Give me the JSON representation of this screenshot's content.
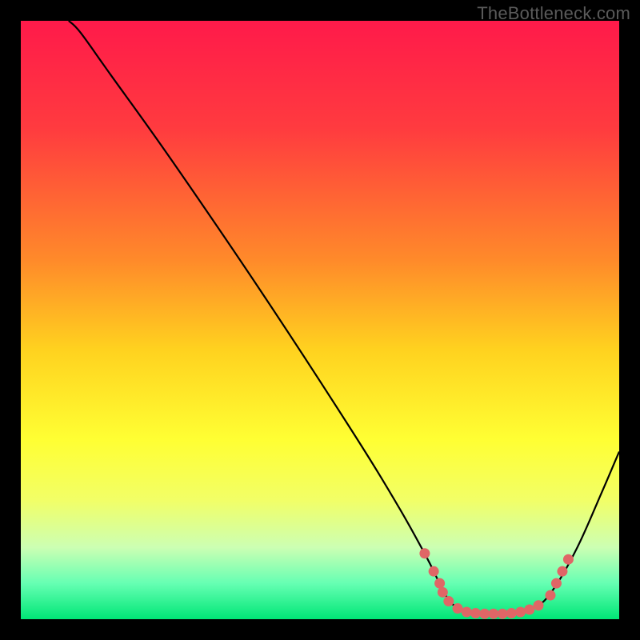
{
  "watermark": "TheBottleneck.com",
  "chart_data": {
    "type": "line",
    "title": "",
    "xlabel": "",
    "ylabel": "",
    "xlim": [
      0,
      100
    ],
    "ylim": [
      0,
      100
    ],
    "gradient_stops": [
      {
        "offset": 0,
        "color": "#ff1a4a"
      },
      {
        "offset": 18,
        "color": "#ff3b3f"
      },
      {
        "offset": 40,
        "color": "#ff8a2a"
      },
      {
        "offset": 55,
        "color": "#ffd21f"
      },
      {
        "offset": 70,
        "color": "#ffff33"
      },
      {
        "offset": 80,
        "color": "#f2ff66"
      },
      {
        "offset": 88,
        "color": "#ccffb3"
      },
      {
        "offset": 94,
        "color": "#66ffb3"
      },
      {
        "offset": 100,
        "color": "#00e676"
      }
    ],
    "series": [
      {
        "name": "bottleneck-curve",
        "type": "line",
        "color": "#000000",
        "points": [
          {
            "x": 8,
            "y": 100
          },
          {
            "x": 10,
            "y": 98
          },
          {
            "x": 15,
            "y": 91
          },
          {
            "x": 25,
            "y": 77
          },
          {
            "x": 40,
            "y": 55
          },
          {
            "x": 55,
            "y": 32
          },
          {
            "x": 63,
            "y": 19
          },
          {
            "x": 68,
            "y": 10
          },
          {
            "x": 71,
            "y": 4
          },
          {
            "x": 73,
            "y": 2
          },
          {
            "x": 77,
            "y": 1
          },
          {
            "x": 82,
            "y": 1
          },
          {
            "x": 86,
            "y": 2
          },
          {
            "x": 89,
            "y": 5
          },
          {
            "x": 93,
            "y": 12
          },
          {
            "x": 97,
            "y": 21
          },
          {
            "x": 100,
            "y": 28
          }
        ]
      },
      {
        "name": "local-minimum-markers",
        "type": "scatter",
        "color": "#e06666",
        "points": [
          {
            "x": 67.5,
            "y": 11
          },
          {
            "x": 69,
            "y": 8
          },
          {
            "x": 70,
            "y": 6
          },
          {
            "x": 70.5,
            "y": 4.5
          },
          {
            "x": 71.5,
            "y": 3
          },
          {
            "x": 73,
            "y": 1.8
          },
          {
            "x": 74.5,
            "y": 1.2
          },
          {
            "x": 76,
            "y": 1
          },
          {
            "x": 77.5,
            "y": 0.9
          },
          {
            "x": 79,
            "y": 0.9
          },
          {
            "x": 80.5,
            "y": 0.9
          },
          {
            "x": 82,
            "y": 1
          },
          {
            "x": 83.5,
            "y": 1.2
          },
          {
            "x": 85,
            "y": 1.6
          },
          {
            "x": 86.5,
            "y": 2.3
          },
          {
            "x": 88.5,
            "y": 4
          },
          {
            "x": 89.5,
            "y": 6
          },
          {
            "x": 90.5,
            "y": 8
          },
          {
            "x": 91.5,
            "y": 10
          }
        ]
      }
    ]
  }
}
